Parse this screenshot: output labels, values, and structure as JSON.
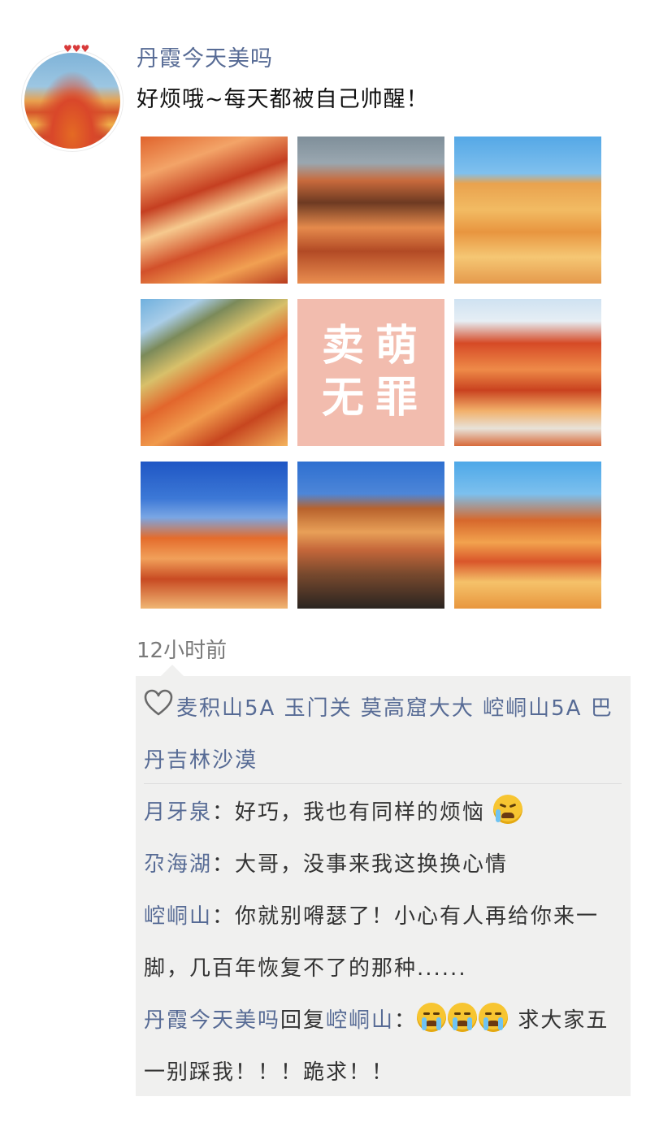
{
  "post": {
    "author": "丹霞今天美吗",
    "text": "好烦哦~每天都被自己帅醒！",
    "timestamp": "12小时前",
    "sticker_text": [
      "卖",
      "萌",
      "无",
      "罪"
    ]
  },
  "likes": {
    "names": "麦积山5A 玉门关 莫高窟大大  崆峒山5A 巴丹吉林沙漠"
  },
  "comments": [
    {
      "name": "月牙泉",
      "sep": "：",
      "text": "好巧，我也有同样的烦恼 ",
      "emoji": [
        "face-with-tears-icon"
      ]
    },
    {
      "name": "尕海湖",
      "sep": "：",
      "text": "大哥，没事来我这换换心情"
    },
    {
      "name": "崆峒山",
      "sep": "：",
      "text": "你就别嘚瑟了！小心有人再给你来一脚，几百年恢复不了的那种......"
    },
    {
      "name": "丹霞今天美吗",
      "reply_word": "回复",
      "reply_to": "崆峒山",
      "sep": "：",
      "emoji": [
        "crying-face-icon",
        "crying-face-icon",
        "crying-face-icon"
      ],
      "text": " 求大家五一别踩我！！！跪求！！"
    }
  ],
  "colors": {
    "name_blue": "#576b95",
    "comment_bg": "#f0f0ef",
    "sticker_bg": "#f2bcae"
  }
}
